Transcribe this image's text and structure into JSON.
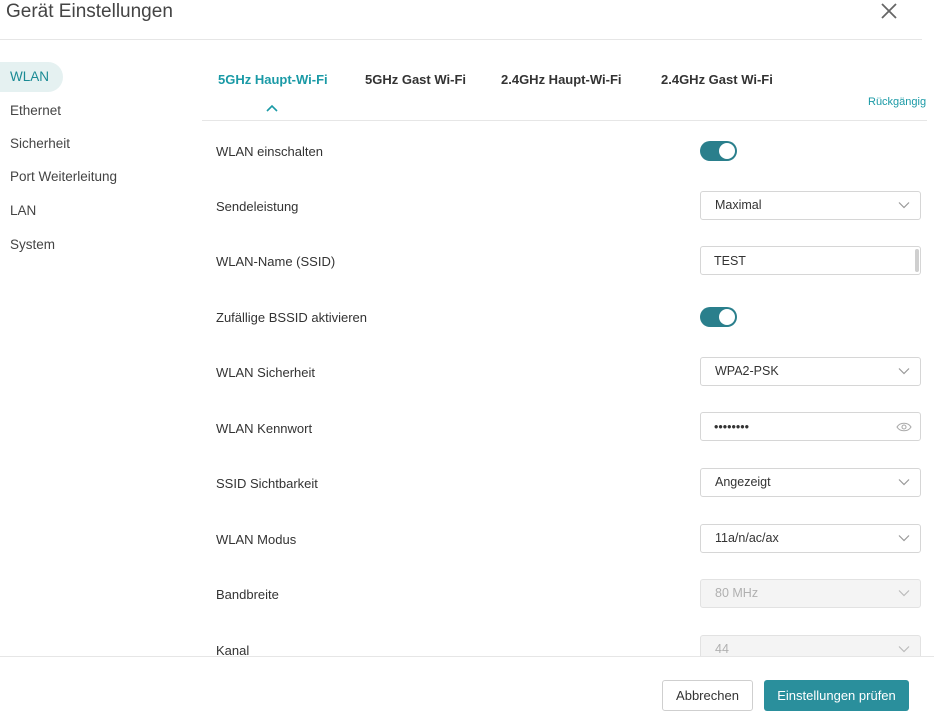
{
  "window": {
    "title": "Gerät Einstellungen",
    "close_icon": "close-icon"
  },
  "colors": {
    "accent": "#1a9aa6",
    "toggle_on": "#2a7f8c",
    "primary_button": "#2a8f9c",
    "active_sidebar_bg": "#e5f1f1"
  },
  "sidebar": {
    "items": [
      {
        "label": "WLAN",
        "active": true
      },
      {
        "label": "Ethernet",
        "active": false
      },
      {
        "label": "Sicherheit",
        "active": false
      },
      {
        "label": "Port Weiterleitung",
        "active": false
      },
      {
        "label": "LAN",
        "active": false
      },
      {
        "label": "System",
        "active": false
      }
    ]
  },
  "tabs": {
    "items": [
      {
        "label": "5GHz Haupt-Wi-Fi",
        "active": true
      },
      {
        "label": "5GHz Gast Wi-Fi",
        "active": false
      },
      {
        "label": "2.4GHz Haupt-Wi-Fi",
        "active": false
      },
      {
        "label": "2.4GHz Gast Wi-Fi",
        "active": false
      }
    ],
    "undo_label": "Rückgängig"
  },
  "form": {
    "wlan_enable": {
      "label": "WLAN einschalten",
      "value": true
    },
    "tx_power": {
      "label": "Sendeleistung",
      "value": "Maximal"
    },
    "ssid": {
      "label": "WLAN-Name (SSID)",
      "value": "TEST"
    },
    "random_bssid": {
      "label": "Zufällige BSSID aktivieren",
      "value": true
    },
    "security": {
      "label": "WLAN Sicherheit",
      "value": "WPA2-PSK"
    },
    "password": {
      "label": "WLAN Kennwort",
      "value": "••••••••"
    },
    "ssid_visibility": {
      "label": "SSID Sichtbarkeit",
      "value": "Angezeigt"
    },
    "mode": {
      "label": "WLAN Modus",
      "value": "11a/n/ac/ax"
    },
    "bandwidth": {
      "label": "Bandbreite",
      "value": "80 MHz",
      "disabled": true
    },
    "channel": {
      "label": "Kanal",
      "value": "44",
      "disabled": true
    }
  },
  "footer": {
    "cancel_label": "Abbrechen",
    "submit_label": "Einstellungen prüfen"
  }
}
